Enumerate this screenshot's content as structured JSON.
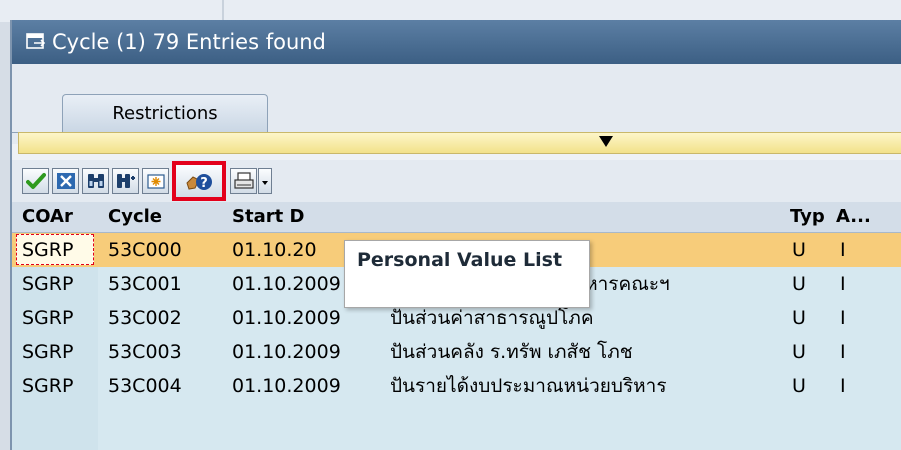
{
  "title": {
    "text": "Cycle (1)   79 Entries found"
  },
  "tabs": [
    {
      "label": "Restrictions"
    }
  ],
  "toolbar": {
    "buttons": [
      {
        "name": "continue-check-icon"
      },
      {
        "name": "cancel-x-icon"
      },
      {
        "name": "find-binoculars-icon"
      },
      {
        "name": "find-next-binoculars-icon"
      },
      {
        "name": "new-entry-icon"
      },
      {
        "name": "personal-value-list-icon"
      },
      {
        "name": "print-icon"
      },
      {
        "name": "dropdown-arrow-icon"
      }
    ]
  },
  "tooltip": {
    "text": "Personal Value List"
  },
  "table": {
    "headers": [
      "COAr",
      "Cycle",
      "Start D",
      "Typ",
      "A..."
    ],
    "rows": [
      {
        "coar": "SGRP",
        "cycle": "53C000",
        "start": "01.10.20",
        "text": "",
        "typ": "U",
        "a": "I",
        "selected": true
      },
      {
        "coar": "SGRP",
        "cycle": "53C001",
        "start": "01.10.2009",
        "text": "ปันส่วนภาระงานด้านบริหารคณะฯ",
        "typ": "U",
        "a": "I"
      },
      {
        "coar": "SGRP",
        "cycle": "53C002",
        "start": "01.10.2009",
        "text": "ปันส่วนค่าสาธารณูปโภค",
        "typ": "U",
        "a": "I"
      },
      {
        "coar": "SGRP",
        "cycle": "53C003",
        "start": "01.10.2009",
        "text": "ปันส่วนคลัง ร.ทรัพ เภสัช โภช",
        "typ": "U",
        "a": "I"
      },
      {
        "coar": "SGRP",
        "cycle": "53C004",
        "start": "01.10.2009",
        "text": "ปันรายได้งบประมาณหน่วยบริหาร",
        "typ": "U",
        "a": "I"
      }
    ]
  },
  "colors": {
    "title_bg": "#4a6d93",
    "selected_row": "#f7cc7a",
    "row_bg": "#d6e8f0",
    "highlight_box": "#e3001b"
  }
}
